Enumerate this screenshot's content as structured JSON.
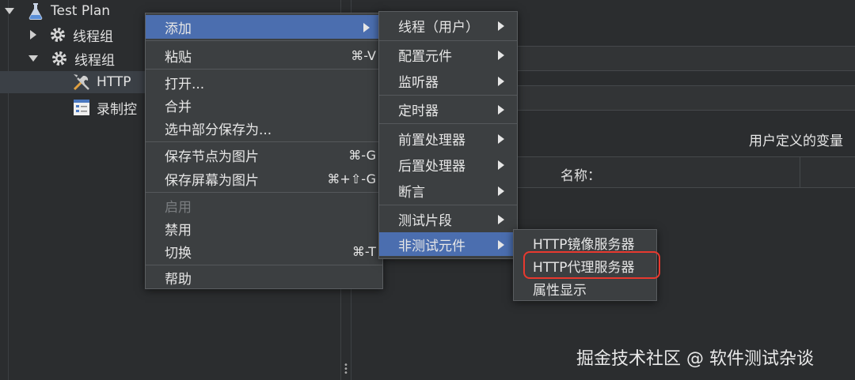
{
  "tree": {
    "items": [
      {
        "label": "Test Plan",
        "icon": "flask-icon",
        "expanded": true
      },
      {
        "label": "线程组",
        "icon": "gear-icon",
        "expanded": false
      },
      {
        "label": "线程组",
        "icon": "gear-icon",
        "expanded": true
      },
      {
        "label": "HTTP",
        "icon": "wrench-screwdriver-icon"
      },
      {
        "label": "录制控",
        "icon": "recording-controller-icon"
      }
    ]
  },
  "panel": {
    "udv_title": "用户定义的变量",
    "table_header_name": "名称："
  },
  "context_menu": {
    "add": "添加",
    "paste": "粘贴",
    "paste_shortcut": "⌘-V",
    "open": "打开...",
    "merge": "合并",
    "save_selection": "选中部分保存为...",
    "save_node_image": "保存节点为图片",
    "save_node_image_shortcut": "⌘-G",
    "save_screen_image": "保存屏幕为图片",
    "save_screen_image_shortcut": "⌘+⇧-G",
    "enable": "启用",
    "disable": "禁用",
    "toggle": "切换",
    "toggle_shortcut": "⌘-T",
    "help": "帮助"
  },
  "add_submenu": {
    "threads": "线程（用户）",
    "config_element": "配置元件",
    "listener": "监听器",
    "timer": "定时器",
    "pre_processor": "前置处理器",
    "post_processor": "后置处理器",
    "assertion": "断言",
    "test_fragment": "测试片段",
    "non_test_elements": "非测试元件"
  },
  "non_test_submenu": {
    "http_mirror_server": "HTTP镜像服务器",
    "http_proxy_server": "HTTP代理服务器",
    "property_display": "属性显示"
  },
  "watermark": "掘金技术社区 @ 软件测试杂谈",
  "colors": {
    "background": "#2b2d2f",
    "menu_background": "#3c3f41",
    "active_item": "#4b6eaf",
    "highlight_border": "#e8392f"
  }
}
